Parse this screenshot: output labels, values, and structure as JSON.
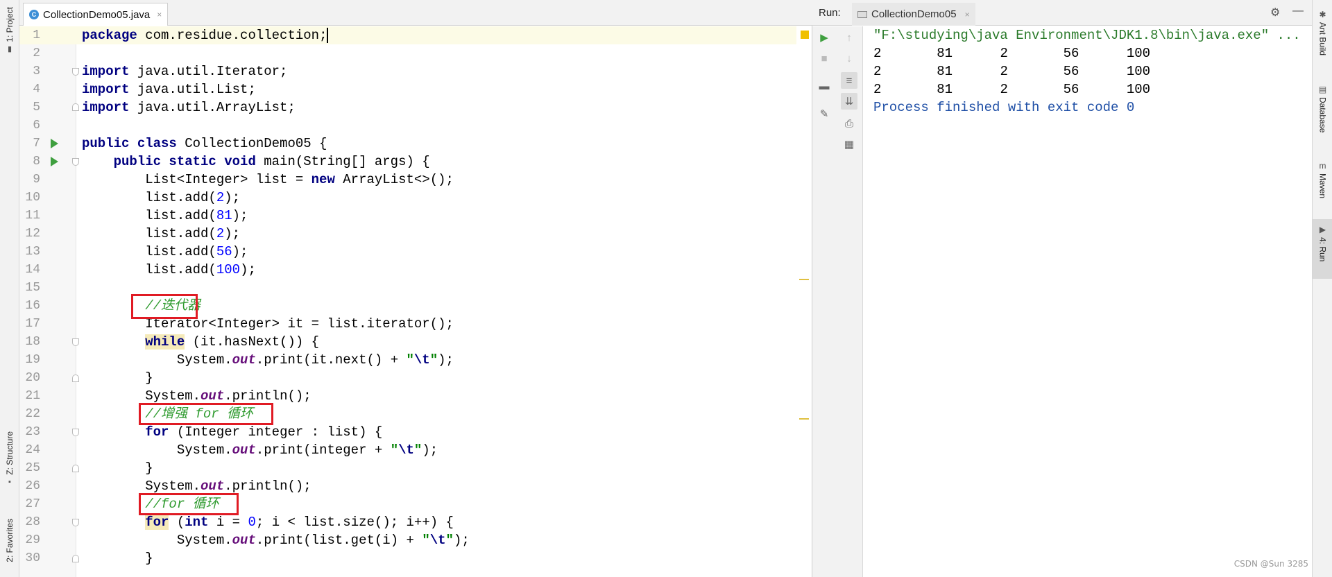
{
  "left_tools": {
    "project": "1: Project",
    "structure": "Z: Structure",
    "favorites": "2: Favorites"
  },
  "editor": {
    "tab": {
      "file_name": "CollectionDemo05.java",
      "close": "×"
    },
    "lines": [
      {
        "n": "1"
      },
      {
        "n": "2"
      },
      {
        "n": "3"
      },
      {
        "n": "4"
      },
      {
        "n": "5"
      },
      {
        "n": "6"
      },
      {
        "n": "7"
      },
      {
        "n": "8"
      },
      {
        "n": "9"
      },
      {
        "n": "10"
      },
      {
        "n": "11"
      },
      {
        "n": "12"
      },
      {
        "n": "13"
      },
      {
        "n": "14"
      },
      {
        "n": "15"
      },
      {
        "n": "16"
      },
      {
        "n": "17"
      },
      {
        "n": "18"
      },
      {
        "n": "19"
      },
      {
        "n": "20"
      },
      {
        "n": "21"
      },
      {
        "n": "22"
      },
      {
        "n": "23"
      },
      {
        "n": "24"
      },
      {
        "n": "25"
      },
      {
        "n": "26"
      },
      {
        "n": "27"
      },
      {
        "n": "28"
      },
      {
        "n": "29"
      },
      {
        "n": "30"
      }
    ],
    "code": {
      "l1a": "package",
      "l1b": " com.residue.collection;",
      "l3a": "import",
      "l3b": " java.util.Iterator;",
      "l4a": "import",
      "l4b": " java.util.List;",
      "l5a": "import",
      "l5b": " java.util.ArrayList;",
      "l7a": "public class",
      "l7b": " CollectionDemo05 {",
      "l8a": "    public static void",
      "l8b": " main(String[] args) {",
      "l9a": "        List<Integer> list = ",
      "l9b": "new",
      "l9c": " ArrayList<>();",
      "l10a": "        list.add(",
      "l10b": "2",
      "l10c": ");",
      "l11a": "        list.add(",
      "l11b": "81",
      "l11c": ");",
      "l12a": "        list.add(",
      "l12b": "2",
      "l12c": ");",
      "l13a": "        list.add(",
      "l13b": "56",
      "l13c": ");",
      "l14a": "        list.add(",
      "l14b": "100",
      "l14c": ");",
      "l16": "        //迭代器",
      "l17": "        Iterator<Integer> it = list.iterator();",
      "l18a": "        ",
      "l18b": "while",
      "l18c": " (it.hasNext()) {",
      "l19a": "            System.",
      "l19b": "out",
      "l19c": ".print(it.next() + ",
      "l19d": "\"",
      "l19e": "\\t",
      "l19f": "\"",
      "l19g": ");",
      "l20": "        }",
      "l21a": "        System.",
      "l21b": "out",
      "l21c": ".println();",
      "l22": "        //增强 for 循环",
      "l23a": "        ",
      "l23b": "for",
      "l23c": " (Integer integer : list) {",
      "l24a": "            System.",
      "l24b": "out",
      "l24c": ".print(integer + ",
      "l24d": "\"",
      "l24e": "\\t",
      "l24f": "\"",
      "l24g": ");",
      "l25": "        }",
      "l26a": "        System.",
      "l26b": "out",
      "l26c": ".println();",
      "l27": "        //for 循环",
      "l28a": "        ",
      "l28b": "for",
      "l28c": " (",
      "l28d": "int",
      "l28e": " i = ",
      "l28f": "0",
      "l28g": "; i < list.size(); i++) {",
      "l29a": "            System.",
      "l29b": "out",
      "l29c": ".print(list.get(i) + ",
      "l29d": "\"",
      "l29e": "\\t",
      "l29f": "\"",
      "l29g": ");",
      "l30": "        }"
    }
  },
  "run_panel": {
    "label": "Run:",
    "tab_name": "CollectionDemo05",
    "tab_close": "×",
    "gear": "⚙",
    "minimize": "—",
    "console": [
      {
        "kind": "cmd",
        "text": "\"F:\\studying\\java Environment\\JDK1.8\\bin\\java.exe\" ..."
      },
      {
        "kind": "out",
        "text": "2\t81\t2\t56\t100"
      },
      {
        "kind": "out",
        "text": "2\t81\t2\t56\t100"
      },
      {
        "kind": "out",
        "text": "2\t81\t2\t56\t100"
      },
      {
        "kind": "exit",
        "text": "Process finished with exit code 0"
      }
    ]
  },
  "right_tools": {
    "ant": "Ant Build",
    "database": "Database",
    "maven": "Maven",
    "run": "4: Run"
  },
  "watermark": "CSDN @Sun 3285"
}
